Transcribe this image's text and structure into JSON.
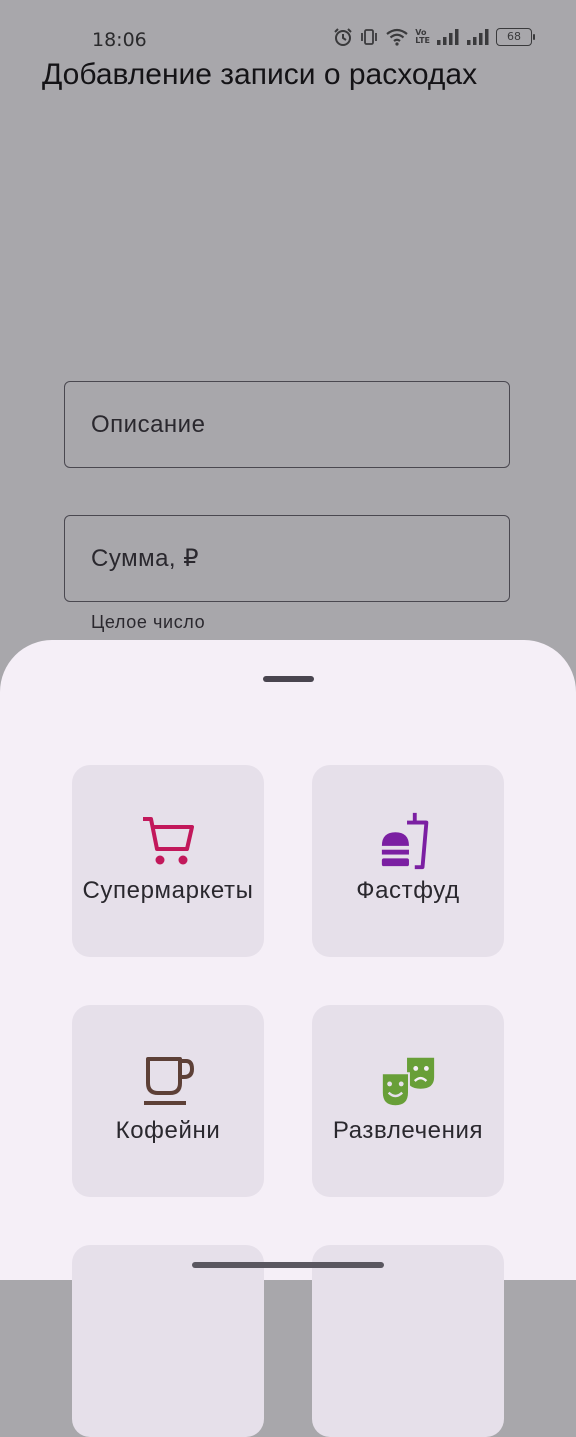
{
  "status_bar": {
    "time": "18:06",
    "lte_top": "Vo",
    "lte_bottom": "LTE",
    "battery": "68"
  },
  "page": {
    "title": "Добавление записи о расходах"
  },
  "form": {
    "description_label": "Описание",
    "amount_label": "Сумма, ₽",
    "amount_helper": "Целое число"
  },
  "categories": [
    {
      "label": "Супермаркеты",
      "icon": "shopping-cart-icon",
      "color": "#c2185b"
    },
    {
      "label": "Фастфуд",
      "icon": "fastfood-icon",
      "color": "#7b1fa2"
    },
    {
      "label": "Кофейни",
      "icon": "coffee-cup-icon",
      "color": "#5d4037"
    },
    {
      "label": "Развлечения",
      "icon": "theater-masks-icon",
      "color": "#689f38"
    }
  ]
}
